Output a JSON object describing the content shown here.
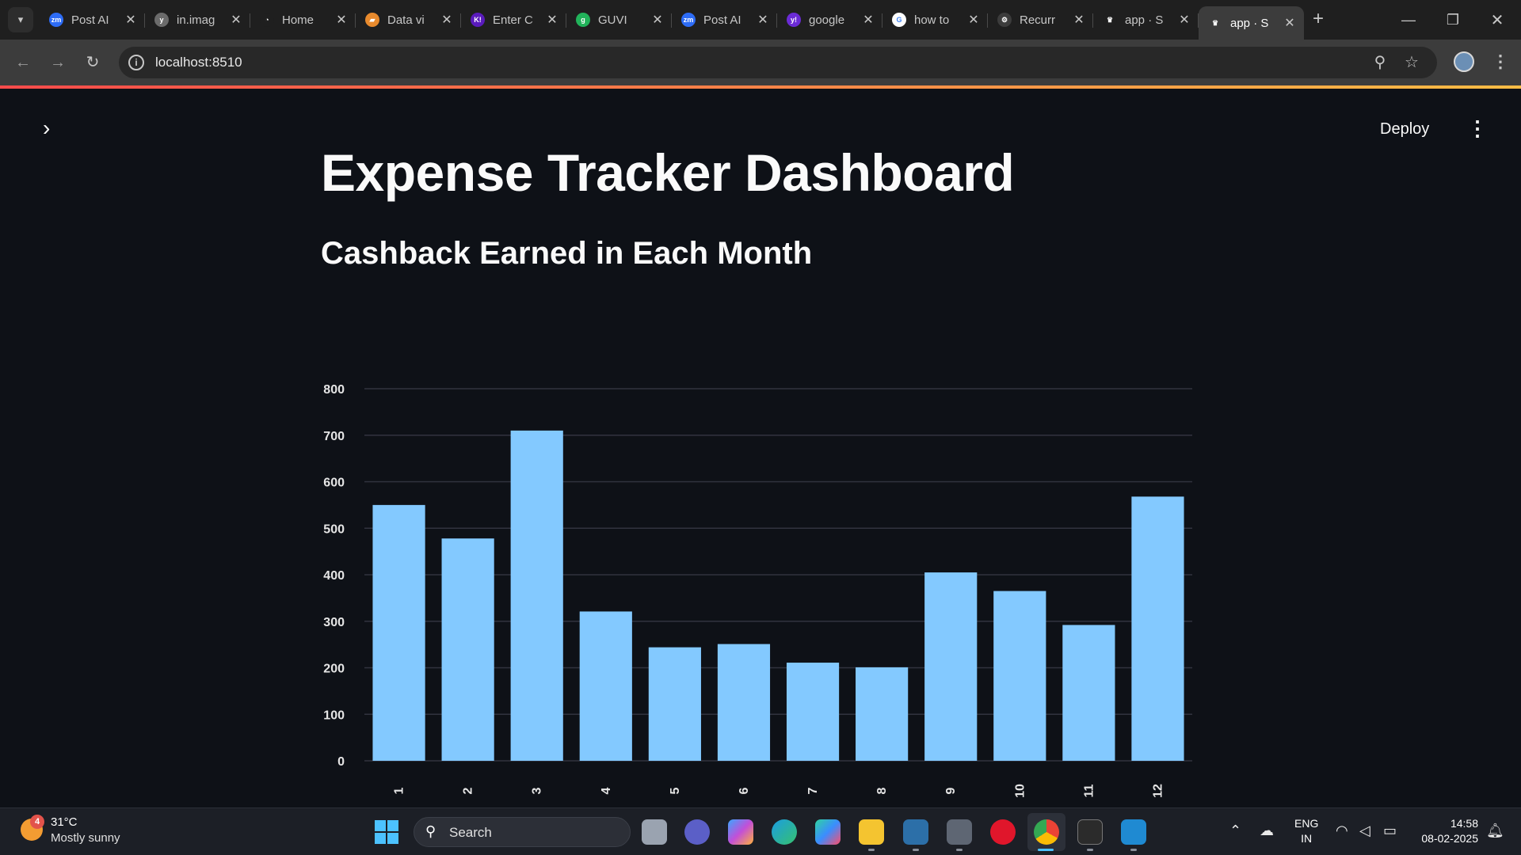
{
  "browser": {
    "tabs": [
      {
        "title": "Post AI",
        "favicon_color": "#2d6cf6",
        "favicon_text": "zm"
      },
      {
        "title": "in.imag",
        "favicon_color": "#6b6b6b",
        "favicon_text": "y"
      },
      {
        "title": "Home",
        "favicon_color": "#1f1f1f",
        "favicon_text": "◔"
      },
      {
        "title": "Data vi",
        "favicon_color": "#e88a2d",
        "favicon_text": "▰"
      },
      {
        "title": "Enter C",
        "favicon_color": "#5a1bbd",
        "favicon_text": "K!"
      },
      {
        "title": "GUVI",
        "favicon_color": "#21b35a",
        "favicon_text": "g"
      },
      {
        "title": "Post AI",
        "favicon_color": "#2d6cf6",
        "favicon_text": "zm"
      },
      {
        "title": "google",
        "favicon_color": "#6b2bd6",
        "favicon_text": "y!"
      },
      {
        "title": "how to",
        "favicon_color": "#ffffff",
        "favicon_text": "G"
      },
      {
        "title": "Recurr",
        "favicon_color": "#3c3c3c",
        "favicon_text": "⚙"
      },
      {
        "title": "app · S",
        "favicon_color": "#1f1f1f",
        "favicon_text": "♛"
      },
      {
        "title": "app · S",
        "favicon_color": "#3c3c3c",
        "favicon_text": "♛",
        "active": true
      }
    ],
    "url": "localhost:8510"
  },
  "app": {
    "deploy_label": "Deploy",
    "title": "Expense Tracker Dashboard",
    "subheader": "Cashback Earned in Each Month"
  },
  "chart_data": {
    "type": "bar",
    "categories": [
      "1",
      "2",
      "3",
      "4",
      "5",
      "6",
      "7",
      "8",
      "9",
      "10",
      "11",
      "12"
    ],
    "values": [
      550,
      478,
      710,
      321,
      244,
      251,
      211,
      201,
      405,
      365,
      292,
      568
    ],
    "ylim": [
      0,
      800
    ],
    "yticks": [
      0,
      100,
      200,
      300,
      400,
      500,
      600,
      700,
      800
    ],
    "bar_color": "#83c9ff",
    "grid": true,
    "xlabel": "",
    "ylabel": ""
  },
  "taskbar": {
    "weather_badge": "4",
    "temperature": "31°C",
    "condition": "Mostly sunny",
    "search_label": "Search",
    "language_line1": "ENG",
    "language_line2": "IN",
    "time": "14:58",
    "date": "08-02-2025"
  }
}
